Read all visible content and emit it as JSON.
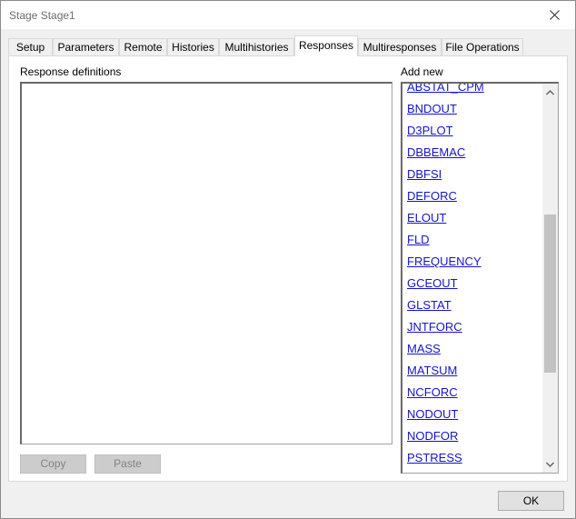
{
  "window": {
    "title": "Stage Stage1",
    "close_icon": "close-icon"
  },
  "tabs": [
    {
      "label": "Setup"
    },
    {
      "label": "Parameters"
    },
    {
      "label": "Remote"
    },
    {
      "label": "Histories"
    },
    {
      "label": "Multihistories"
    },
    {
      "label": "Responses",
      "active": true
    },
    {
      "label": "Multiresponses"
    },
    {
      "label": "File Operations"
    }
  ],
  "responses": {
    "definitions_label": "Response definitions",
    "add_new_label": "Add new",
    "copy_label": "Copy",
    "paste_label": "Paste",
    "items": [
      "ABSTAT_CPM",
      "BNDOUT",
      "D3PLOT",
      "DBBEMAC",
      "DBFSI",
      "DEFORC",
      "ELOUT",
      "FLD",
      "FREQUENCY",
      "GCEOUT",
      "GLSTAT",
      "JNTFORC",
      "MASS",
      "MATSUM",
      "NCFORC",
      "NODOUT",
      "NODFOR",
      "PSTRESS"
    ]
  },
  "footer": {
    "ok_label": "OK"
  },
  "colors": {
    "link": "#1414c8",
    "disabled_button": "#cccccc",
    "dialog_bg": "#f0f0f0"
  }
}
